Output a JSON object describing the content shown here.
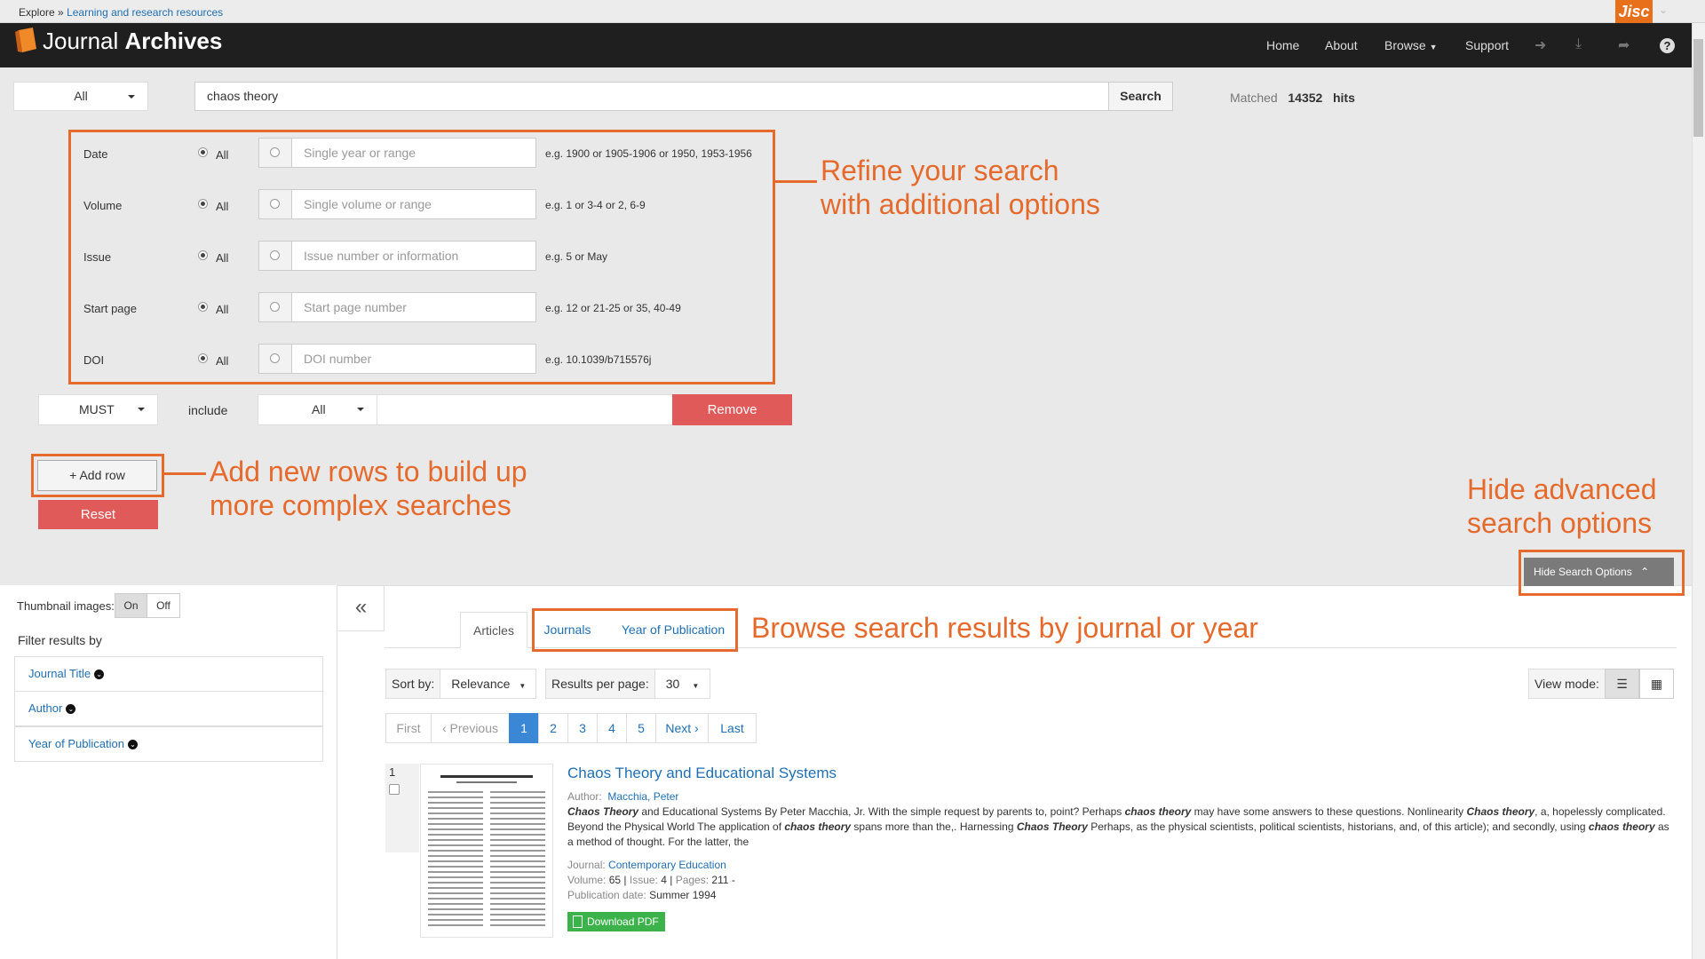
{
  "breadcrumb": {
    "root": "Explore",
    "separator": "»",
    "current": "Learning and research resources"
  },
  "brand": {
    "logo_plain": "Journal ",
    "logo_bold": "Archives",
    "jisc": "Jisc"
  },
  "nav": {
    "home": "Home",
    "about": "About",
    "browse": "Browse",
    "support": "Support"
  },
  "search": {
    "field": "All",
    "query": "chaos theory",
    "button": "Search",
    "matched_label": "Matched",
    "hits": "14352",
    "hits_label": "hits"
  },
  "advanced": [
    {
      "label": "Date",
      "all": "All",
      "placeholder": "Single year or range",
      "example": "e.g. 1900 or 1905-1906 or 1950, 1953-1956"
    },
    {
      "label": "Volume",
      "all": "All",
      "placeholder": "Single volume or range",
      "example": "e.g. 1 or 3-4 or 2, 6-9"
    },
    {
      "label": "Issue",
      "all": "All",
      "placeholder": "Issue number or information",
      "example": "e.g. 5 or May"
    },
    {
      "label": "Start page",
      "all": "All",
      "placeholder": "Start page number",
      "example": "e.g. 12 or 21-25 or 35, 40-49"
    },
    {
      "label": "DOI",
      "all": "All",
      "placeholder": "DOI number",
      "example": "e.g. 10.1039/b715576j"
    }
  ],
  "row": {
    "operator": "MUST",
    "include": "include",
    "field": "All",
    "remove": "Remove"
  },
  "buttons": {
    "add_row": "+ Add row",
    "reset": "Reset",
    "hide": "Hide Search Options"
  },
  "callouts": {
    "refine_1": "Refine your search",
    "refine_2": "with additional options",
    "add_1": "Add new rows to build up",
    "add_2": "more complex searches",
    "hide_1": "Hide advanced",
    "hide_2": "search options",
    "browse": "Browse search results by journal or year"
  },
  "sidebar": {
    "thumb_label": "Thumbnail images:",
    "on": "On",
    "off": "Off",
    "filter_head": "Filter results by",
    "facets": [
      "Journal Title",
      "Author",
      "Year of Publication"
    ]
  },
  "tabs": {
    "articles": "Articles",
    "journals": "Journals",
    "year": "Year of Publication"
  },
  "controls": {
    "sort_label": "Sort by:",
    "sort_value": "Relevance",
    "rpp_label": "Results per page:",
    "rpp_value": "30",
    "view_label": "View mode:"
  },
  "pager": {
    "first": "First",
    "prev": "‹ Previous",
    "pages": [
      "1",
      "2",
      "3",
      "4",
      "5"
    ],
    "next": "Next ›",
    "last": "Last"
  },
  "result": {
    "number": "1",
    "title": "Chaos Theory and Educational Systems",
    "author_label": "Author:",
    "author": "Macchia, Peter",
    "journal_label": "Journal:",
    "journal": "Contemporary Education",
    "volume_label": "Volume:",
    "volume": "65",
    "issue_label": "Issue:",
    "issue": "4",
    "pages_label": "Pages:",
    "pages": "211 -",
    "date_label": "Publication date:",
    "date": "Summer 1994",
    "download": "Download PDF"
  }
}
